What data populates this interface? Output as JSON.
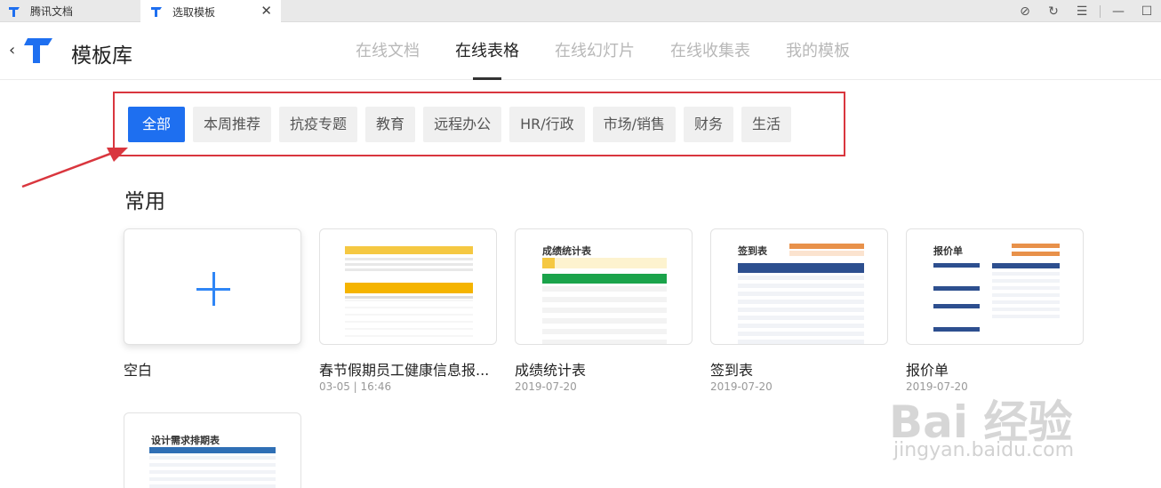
{
  "tabs": [
    {
      "label": "腾讯文档"
    },
    {
      "label": "选取模板"
    }
  ],
  "header": {
    "title": "模板库",
    "nav": [
      "在线文档",
      "在线表格",
      "在线幻灯片",
      "在线收集表",
      "我的模板"
    ],
    "active_nav": "在线表格"
  },
  "categories": [
    "全部",
    "本周推荐",
    "抗疫专题",
    "教育",
    "远程办公",
    "HR/行政",
    "市场/销售",
    "财务",
    "生活"
  ],
  "section": {
    "title": "常用"
  },
  "cards": [
    {
      "name": "空白",
      "date": ""
    },
    {
      "name": "春节假期员工健康信息报...",
      "date": "03-05 | 16:46"
    },
    {
      "name": "成绩统计表",
      "date": "2019-07-20"
    },
    {
      "name": "签到表",
      "date": "2019-07-20"
    },
    {
      "name": "报价单",
      "date": "2019-07-20"
    }
  ],
  "thumbs": {
    "grades": "成绩统计表",
    "signin": "签到表",
    "quote": "报价单",
    "design": "设计需求排期表"
  },
  "watermark": {
    "brand": "Bai 经验",
    "domain": "jingyan.baidu.com"
  },
  "colors": {
    "accent": "#1e6ff0",
    "highlight_box": "#d9363e",
    "plus": "#2f86f6"
  }
}
